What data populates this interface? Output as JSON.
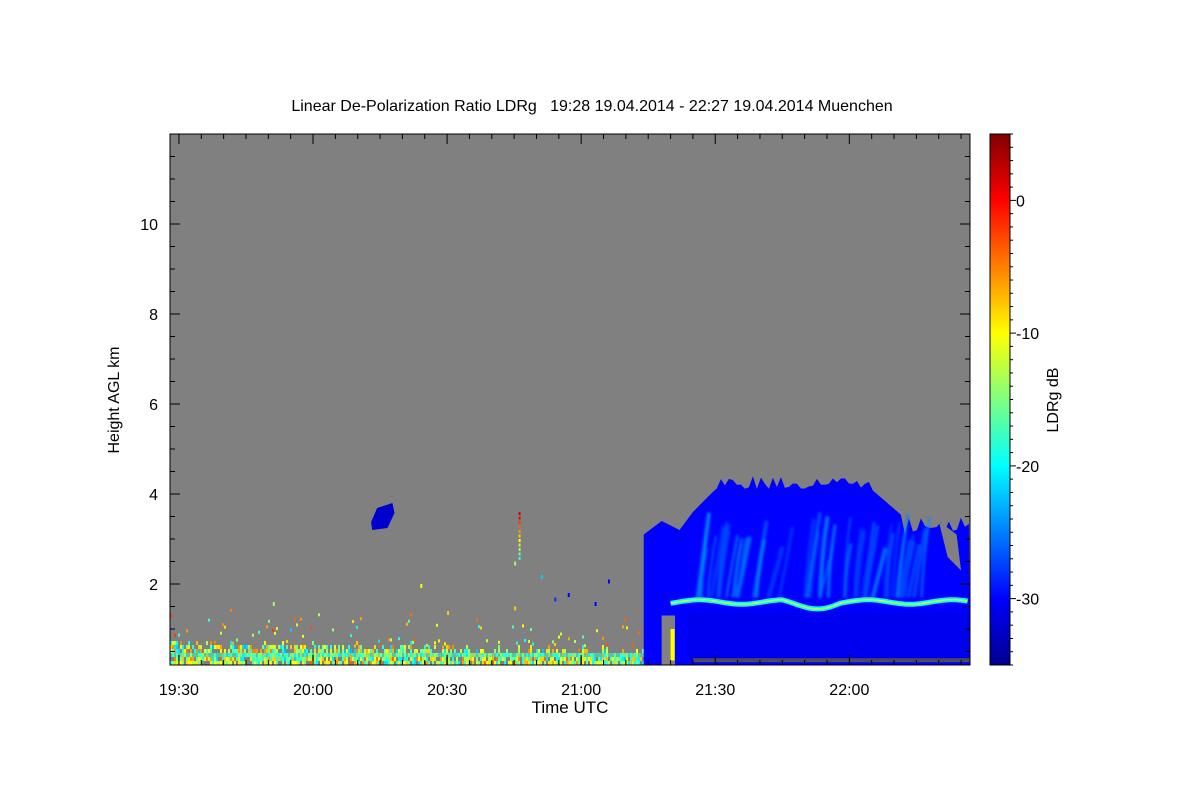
{
  "chart_data": {
    "type": "heatmap",
    "title": "Linear De-Polarization Ratio LDRg   19:28 19.04.2014 - 22:27 19.04.2014 Muenchen",
    "xlabel": "Time UTC",
    "ylabel": "Height AGL km",
    "colorbar_label": "LDRg dB",
    "x_range": [
      "19:28",
      "22:27"
    ],
    "x_ticks": [
      "19:30",
      "20:00",
      "20:30",
      "21:00",
      "21:30",
      "22:00"
    ],
    "y_ticks": [
      2,
      4,
      6,
      8,
      10
    ],
    "ylim": [
      0.2,
      12
    ],
    "colorbar_ticks": [
      0,
      -10,
      -20,
      -30
    ],
    "colorbar_range": [
      -35,
      5
    ],
    "colormap": "jet",
    "no_data_color": "#808080",
    "features": [
      {
        "name": "boundary layer aerosol",
        "start": "19:28",
        "end": "21:20",
        "base_km": 0.2,
        "top_km": 1.0,
        "ldr_db": -12
      },
      {
        "name": "small cloud",
        "start": "20:13",
        "end": "20:18",
        "base_km": 3.2,
        "top_km": 3.8,
        "ldr_db": -32
      },
      {
        "name": "precipitating cloud",
        "start": "21:14",
        "end": "22:27",
        "base_km": 0.2,
        "top_km": 4.4,
        "ldr_db": -30
      },
      {
        "name": "melting layer",
        "start": "21:20",
        "end": "22:27",
        "base_km": 1.5,
        "top_km": 1.7,
        "ldr_db": -18
      }
    ]
  }
}
